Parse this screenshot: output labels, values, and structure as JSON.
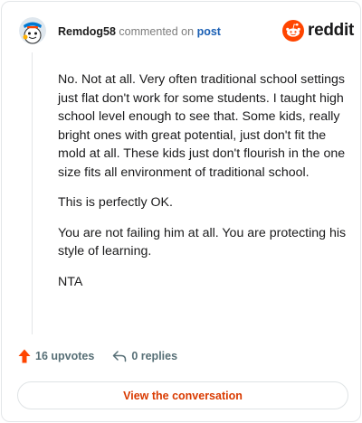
{
  "header": {
    "username": "Remdog58",
    "action_text": "commented on",
    "post_link": "post",
    "brand": "reddit"
  },
  "comment": {
    "paragraphs": [
      "No. Not at all. Very often traditional school settings just flat don't work for some students. I taught high school level enough to see that. Some kids, really bright ones with great potential, just don't fit the mold at all. These kids just don't flourish in the one size fits all environment of traditional school.",
      "This is perfectly OK.",
      "You are not failing him at all. You are protecting his style of learning.",
      "NTA"
    ]
  },
  "footer": {
    "upvotes": "16 upvotes",
    "replies": "0 replies",
    "view_button": "View the conversation"
  },
  "colors": {
    "accent": "#ff4500",
    "link": "#1a5fb4",
    "view_button_text": "#d93a00",
    "muted": "#576f76"
  },
  "icons": [
    "avatar-snoo",
    "reddit-logo-icon",
    "upvote-arrow-icon",
    "reply-arrow-icon"
  ]
}
